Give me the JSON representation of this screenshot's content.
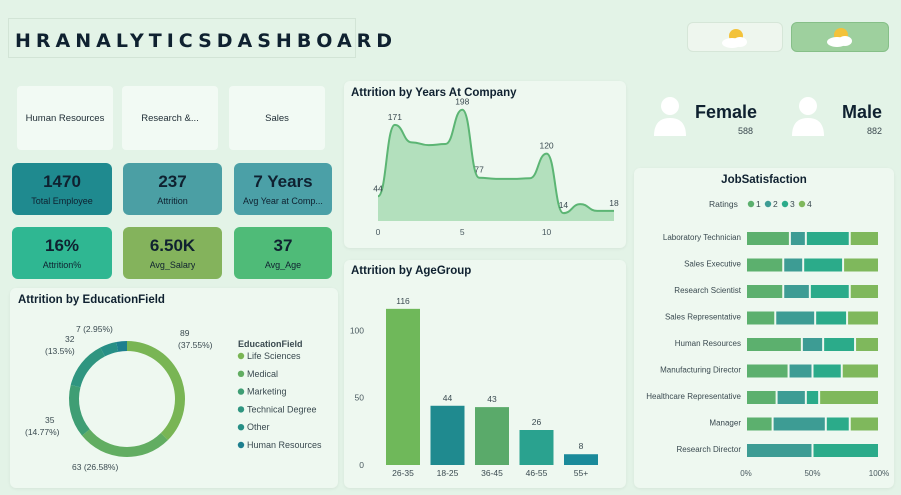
{
  "header": {
    "title": "HRANALYTICSDASHBOARD",
    "theme_toggle": [
      "light-mode-icon",
      "dark-mode-icon"
    ]
  },
  "slicers": [
    "Human Resources",
    "Research &...",
    "Sales"
  ],
  "kpis": [
    {
      "value": "1470",
      "label": "Total Employee",
      "color": "#1f8a8f"
    },
    {
      "value": "237",
      "label": "Attrition",
      "color": "#4b9fa4"
    },
    {
      "value": "7 Years",
      "label": "Avg Year at Comp...",
      "color": "#4ba0a7"
    },
    {
      "value": "16%",
      "label": "Attrition%",
      "color": "#2fb792"
    },
    {
      "value": "6.50K",
      "label": "Avg_Salary",
      "color": "#84b35c"
    },
    {
      "value": "37",
      "label": "Avg_Age",
      "color": "#4fbb78"
    }
  ],
  "gender": {
    "female": {
      "label": "Female",
      "count": "588"
    },
    "male": {
      "label": "Male",
      "count": "882"
    }
  },
  "years_chart": {
    "title": "Attrition by Years At Company",
    "chart_data": {
      "type": "area",
      "x": [
        0,
        1,
        2,
        3,
        4,
        5,
        6,
        7,
        8,
        9,
        10,
        11,
        12,
        13,
        14
      ],
      "values": [
        44,
        171,
        140,
        135,
        137,
        198,
        77,
        75,
        75,
        76,
        120,
        14,
        30,
        18,
        18
      ],
      "labels": [
        "44",
        "171",
        "",
        "",
        "",
        "198",
        "77",
        "",
        "",
        "",
        "120",
        "14",
        "",
        "",
        "18"
      ],
      "xticks": [
        "0",
        "5",
        "10"
      ],
      "yticks": [
        "200",
        "150",
        "100",
        "50",
        "0"
      ],
      "ylim": [
        0,
        210
      ]
    }
  },
  "age_chart": {
    "title": "Attrition by AgeGroup",
    "chart_data": {
      "type": "bar",
      "categories": [
        "26-35",
        "18-25",
        "36-45",
        "46-55",
        "55+"
      ],
      "values": [
        116,
        44,
        43,
        26,
        8
      ],
      "colors": [
        "#6fb85a",
        "#1f8a8f",
        "#5aaa6a",
        "#2aa28f",
        "#1a8a9a"
      ],
      "yticks": [
        "100",
        "50",
        "0"
      ],
      "ylim": [
        0,
        130
      ]
    }
  },
  "edu_chart": {
    "title": "Attrition by EducationField",
    "legend_title": "EducationField",
    "chart_data": {
      "type": "pie",
      "categories": [
        "Life Sciences",
        "Medical",
        "Marketing",
        "Technical Degree",
        "Other",
        "Human Resources"
      ],
      "values": [
        89,
        63,
        35,
        32,
        11,
        7
      ],
      "colors": [
        "#79b554",
        "#62ad62",
        "#3f9e74",
        "#2f9580",
        "#278f86",
        "#1d7f8e"
      ],
      "annotations": [
        "89\n(37.55%)",
        "63 (26.58%)",
        "35\n(14.77%)",
        "32\n(13.5%)",
        "",
        "7 (2.95%)"
      ]
    }
  },
  "job_chart": {
    "title": "JobSatisfaction",
    "legend_title": "Ratings",
    "legend": [
      "1",
      "2",
      "3",
      "4"
    ],
    "colors": [
      "#5cb06e",
      "#3d9c94",
      "#2bab8a",
      "#7fb85c"
    ],
    "xticks": [
      "0%",
      "50%",
      "100%"
    ],
    "chart_data": {
      "type": "bar",
      "categories": [
        "Laboratory Technician",
        "Sales Executive",
        "Research Scientist",
        "Sales Representative",
        "Human Resources",
        "Manufacturing Director",
        "Healthcare Representative",
        "Manager",
        "Research Director"
      ],
      "series": [
        {
          "name": "1",
          "values": [
            0.33,
            0.28,
            0.28,
            0.22,
            0.42,
            0.32,
            0.23,
            0.2,
            0.0
          ]
        },
        {
          "name": "2",
          "values": [
            0.12,
            0.15,
            0.2,
            0.3,
            0.16,
            0.18,
            0.22,
            0.4,
            0.5
          ]
        },
        {
          "name": "3",
          "values": [
            0.33,
            0.3,
            0.3,
            0.24,
            0.24,
            0.22,
            0.1,
            0.18,
            0.5
          ]
        },
        {
          "name": "4",
          "values": [
            0.22,
            0.27,
            0.22,
            0.24,
            0.18,
            0.28,
            0.45,
            0.22,
            0.0
          ]
        }
      ]
    }
  }
}
